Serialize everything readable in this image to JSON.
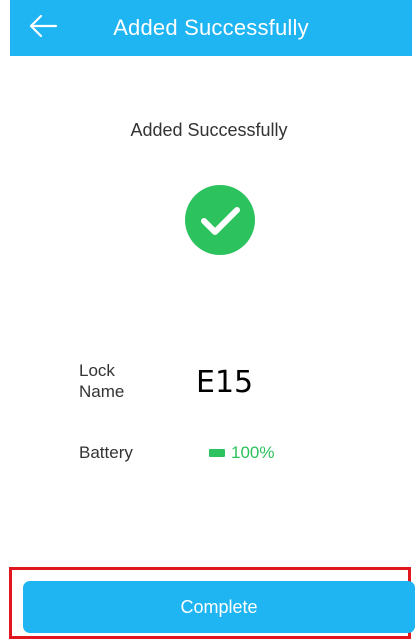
{
  "header": {
    "title": "Added Successfully",
    "back_icon": "arrow-left-icon",
    "background": "#1fb4f2"
  },
  "status": {
    "message": "Added Successfully",
    "icon": "check-circle-icon",
    "color": "#2cc25d"
  },
  "info": {
    "lock_name_label": "Lock Name",
    "lock_name_value": "E15",
    "battery_label": "Battery",
    "battery_value": "100%",
    "battery_icon": "battery-icon",
    "battery_level_percent": 100
  },
  "actions": {
    "complete_label": "Complete",
    "highlight_color": "#e0171f"
  }
}
